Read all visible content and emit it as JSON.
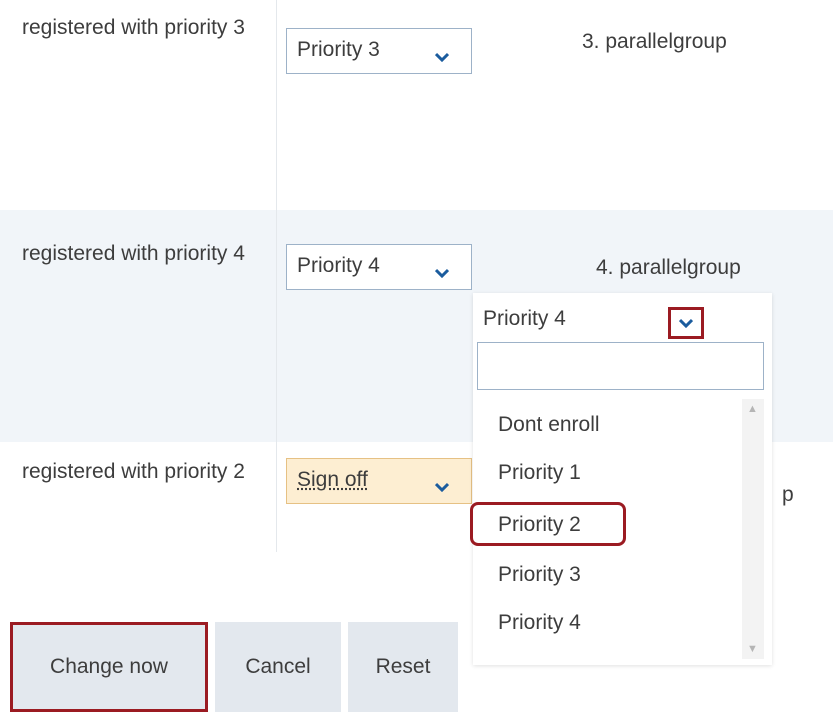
{
  "rows": [
    {
      "status": "registered with priority 3",
      "priority_value": "Priority 3",
      "group": "3. parallelgroup"
    },
    {
      "status": "registered with priority 4",
      "priority_value": "Priority 4",
      "group": "4. parallelgroup"
    },
    {
      "status": "registered with priority 2",
      "priority_value": "Sign off",
      "group_partial": "p"
    }
  ],
  "dropdown": {
    "selected": "Priority 4",
    "search_value": "",
    "options": [
      "Dont enroll",
      "Priority 1",
      "Priority 2",
      "Priority 3",
      "Priority 4"
    ],
    "highlighted_option": "Priority 2"
  },
  "buttons": {
    "change_now": "Change now",
    "cancel": "Cancel",
    "reset": "Reset"
  },
  "colors": {
    "accent_highlight": "#9b1b22",
    "chevron": "#1b5c9e",
    "signoff_bg": "#fdeed2",
    "row_alt_bg": "#f1f5f9",
    "button_bg": "#e3e8ee"
  },
  "icons": {
    "select_toggle": "chevron-down-icon",
    "scroll_up": "scroll-up-icon",
    "scroll_down": "scroll-down-icon"
  }
}
